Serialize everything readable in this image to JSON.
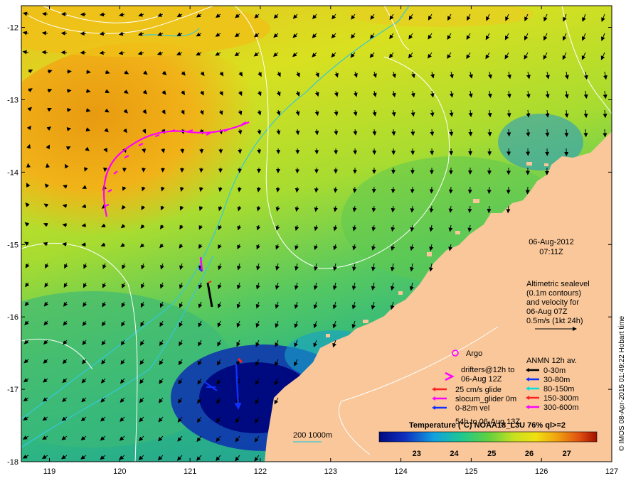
{
  "map": {
    "datetime": {
      "date": "06-Aug-2012",
      "time": "07:11Z"
    },
    "altimetry_note": [
      "Altimetric sealevel",
      "(0.1m contours)",
      "and velocity for",
      "06-Aug 07Z",
      "0.5m/s (1kt 24h)"
    ],
    "legend": {
      "argo": "Argo",
      "drifters": [
        "drifters@12h to",
        "06-Aug 12Z"
      ],
      "glider_items": [
        {
          "label": "25 cm/s glide",
          "color": "#ff2020"
        },
        {
          "label": "slocum_glider 0m",
          "color": "#ff00ff"
        },
        {
          "label": "0-82m vel",
          "color": "#1030ff"
        }
      ],
      "glider_extra": "54h to 06-Aug 13Z",
      "anmn_title": "ANMN 12h av.",
      "anmn_items": [
        {
          "label": "0-30m",
          "color": "#000000"
        },
        {
          "label": "30-80m",
          "color": "#1030ff"
        },
        {
          "label": "80-150m",
          "color": "#00e0e0"
        },
        {
          "label": "150-300m",
          "color": "#ff2020"
        },
        {
          "label": "300-600m",
          "color": "#ff00ff"
        }
      ]
    },
    "bathymetry_label": "200  1000m",
    "colorbar": {
      "title": "Temperature (°C) NOAA18_L3U 76% ql>=2",
      "ticks": [
        "23",
        "24",
        "25",
        "26",
        "27"
      ],
      "range": [
        22.0,
        27.8
      ]
    },
    "axes": {
      "lon_ticks": [
        "119",
        "120",
        "121",
        "122",
        "123",
        "124",
        "125",
        "126",
        "127"
      ],
      "lat_ticks": [
        "-12",
        "-13",
        "-14",
        "-15",
        "-16",
        "-17",
        "-18"
      ],
      "lon_range": [
        118.6,
        127.0
      ],
      "lat_range": [
        -18.0,
        -11.7
      ]
    },
    "credit": "© IMOS 08-Apr-2015 01:49:22 Hobart time",
    "colors": {
      "land": "#f9c79a",
      "contour": "#ffffff",
      "isobath": "#35c8d8",
      "vector": "#000000",
      "drifter": "#ff00ff",
      "argo": "#ff00ff"
    }
  }
}
